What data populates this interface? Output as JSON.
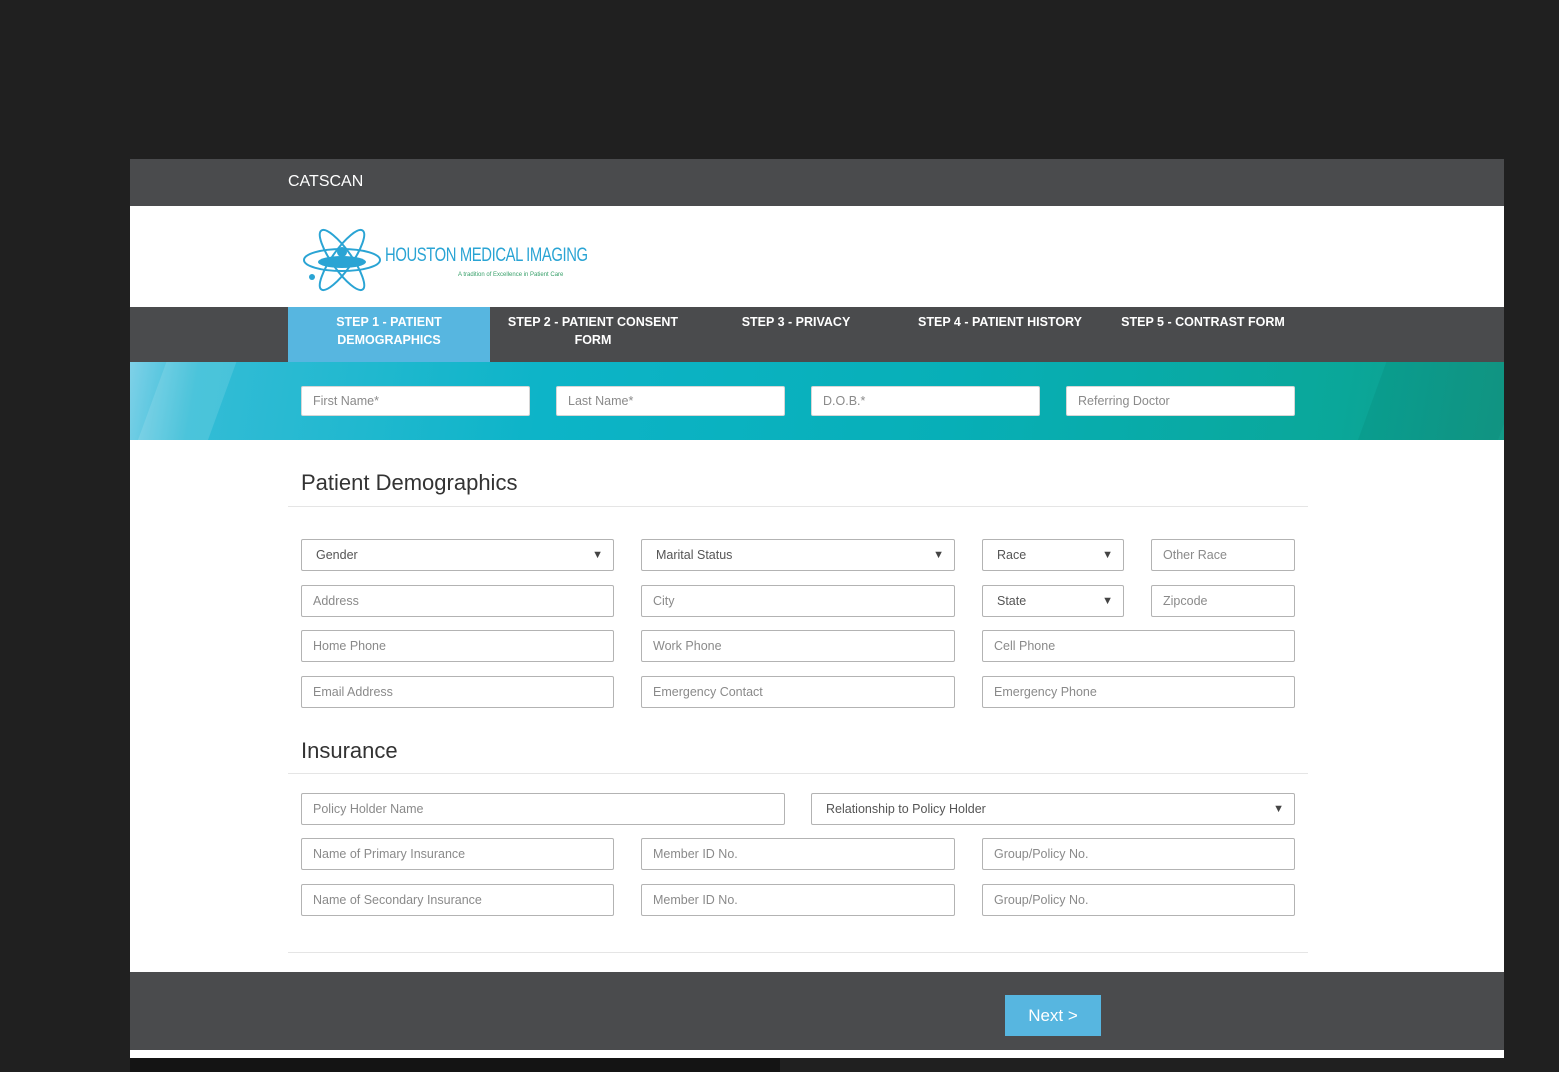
{
  "app": {
    "title": "CATSCAN"
  },
  "logo": {
    "name": "HOUSTON MEDICAL IMAGING",
    "tagline": "A tradition of Excellence in Patient Care"
  },
  "steps": [
    {
      "line1": "STEP 1 - PATIENT",
      "line2": "DEMOGRAPHICS",
      "active": true
    },
    {
      "line1": "STEP 2 - PATIENT CONSENT",
      "line2": "FORM",
      "active": false
    },
    {
      "line1": "STEP 3 - PRIVACY",
      "line2": "",
      "active": false
    },
    {
      "line1": "STEP 4 - PATIENT HISTORY",
      "line2": "",
      "active": false
    },
    {
      "line1": "STEP 5 - CONTRAST FORM",
      "line2": "",
      "active": false
    }
  ],
  "banner": {
    "first_name": "First Name*",
    "last_name": "Last Name*",
    "dob": "D.O.B.*",
    "referring_doctor": "Referring Doctor"
  },
  "demographics": {
    "title": "Patient Demographics",
    "gender": "Gender",
    "marital_status": "Marital Status",
    "race": "Race",
    "other_race": "Other Race",
    "address": "Address",
    "city": "City",
    "state": "State",
    "zipcode": "Zipcode",
    "home_phone": "Home Phone",
    "work_phone": "Work Phone",
    "cell_phone": "Cell Phone",
    "email": "Email Address",
    "emergency_contact": "Emergency Contact",
    "emergency_phone": "Emergency Phone"
  },
  "insurance": {
    "title": "Insurance",
    "policy_holder": "Policy Holder Name",
    "relationship": "Relationship to Policy Holder",
    "primary_name": "Name of Primary Insurance",
    "primary_member": "Member ID No.",
    "primary_group": "Group/Policy No.",
    "secondary_name": "Name of Secondary Insurance",
    "secondary_member": "Member ID No.",
    "secondary_group": "Group/Policy No."
  },
  "footer": {
    "next_label": "Next >"
  },
  "colors": {
    "bar": "#4a4b4d",
    "accent": "#57b6e0",
    "page_bg": "#202020"
  }
}
